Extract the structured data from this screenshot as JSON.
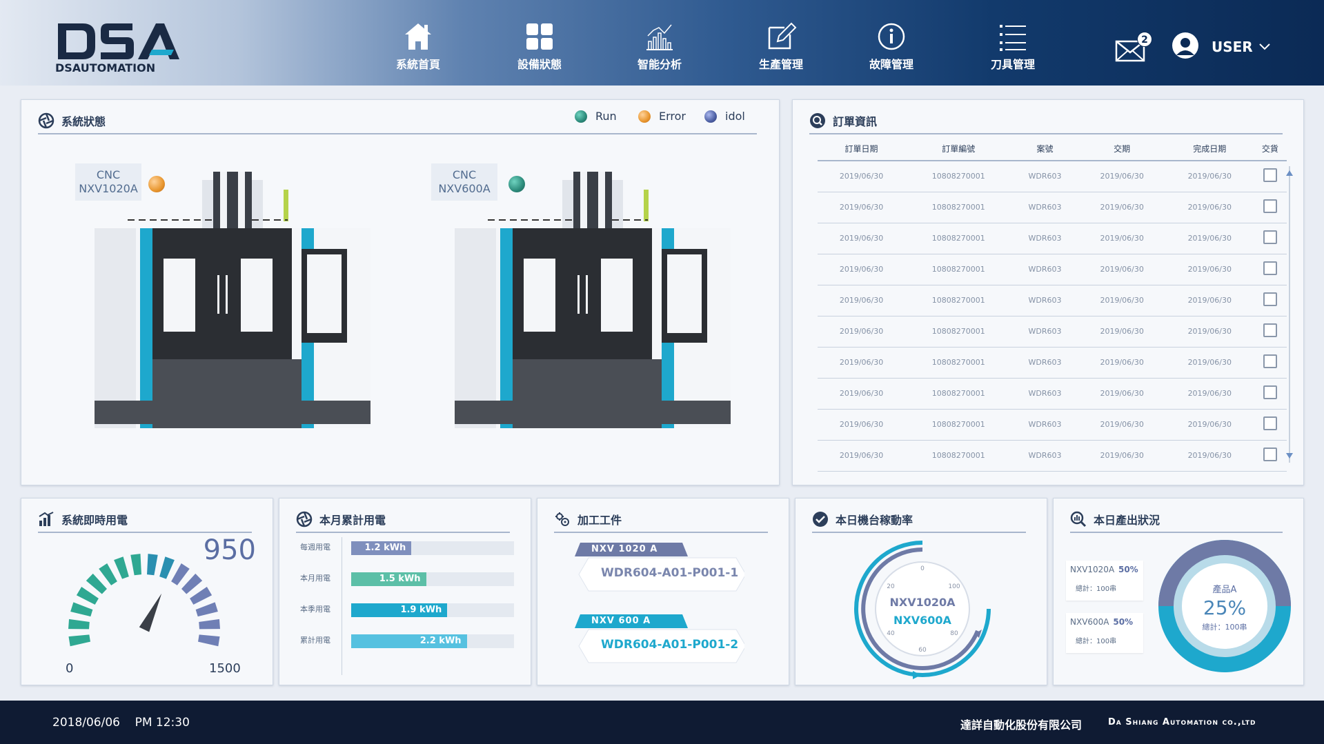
{
  "header": {
    "logo_text": "DSA",
    "logo_subtext": "DSAUTOMATION",
    "nav": [
      {
        "label": "系統首頁",
        "icon": "home-icon"
      },
      {
        "label": "設備狀態",
        "icon": "grid-icon"
      },
      {
        "label": "智能分析",
        "icon": "chart-icon"
      },
      {
        "label": "生產管理",
        "icon": "edit-icon"
      },
      {
        "label": "故障管理",
        "icon": "info-icon"
      },
      {
        "label": "刀具管理",
        "icon": "list-icon"
      }
    ],
    "mail_badge": "2",
    "user": "USER"
  },
  "status": {
    "title": "系統狀態",
    "legend": [
      {
        "label": "Run",
        "color": "#2b8a7a"
      },
      {
        "label": "Error",
        "color": "#e8962e"
      },
      {
        "label": "idol",
        "color": "#4c5fa3"
      }
    ],
    "machines": [
      {
        "line1": "CNC",
        "line2": "NXV1020A",
        "status_color": "#e8962e"
      },
      {
        "line1": "CNC",
        "line2": "NXV600A",
        "status_color": "#2b8a7a"
      }
    ]
  },
  "orders": {
    "title": "訂單資訊",
    "columns": [
      "訂單日期",
      "訂單編號",
      "案號",
      "交期",
      "完成日期",
      "交貨"
    ],
    "rows": [
      [
        "2019/06/30",
        "10808270001",
        "WDR603",
        "2019/06/30",
        "2019/06/30"
      ],
      [
        "2019/06/30",
        "10808270001",
        "WDR603",
        "2019/06/30",
        "2019/06/30"
      ],
      [
        "2019/06/30",
        "10808270001",
        "WDR603",
        "2019/06/30",
        "2019/06/30"
      ],
      [
        "2019/06/30",
        "10808270001",
        "WDR603",
        "2019/06/30",
        "2019/06/30"
      ],
      [
        "2019/06/30",
        "10808270001",
        "WDR603",
        "2019/06/30",
        "2019/06/30"
      ],
      [
        "2019/06/30",
        "10808270001",
        "WDR603",
        "2019/06/30",
        "2019/06/30"
      ],
      [
        "2019/06/30",
        "10808270001",
        "WDR603",
        "2019/06/30",
        "2019/06/30"
      ],
      [
        "2019/06/30",
        "10808270001",
        "WDR603",
        "2019/06/30",
        "2019/06/30"
      ],
      [
        "2019/06/30",
        "10808270001",
        "WDR603",
        "2019/06/30",
        "2019/06/30"
      ],
      [
        "2019/06/30",
        "10808270001",
        "WDR603",
        "2019/06/30",
        "2019/06/30"
      ]
    ]
  },
  "power": {
    "title": "系統即時用電",
    "value": "950",
    "min": "0",
    "max": "1500",
    "fraction": 0.63
  },
  "monthly": {
    "title": "本月累計用電",
    "bars": [
      {
        "label": "每週用電",
        "value": "1.2 kWh",
        "fraction": 0.37,
        "color": "#7f8fbd"
      },
      {
        "label": "本月用電",
        "value": "1.5 kWh",
        "fraction": 0.46,
        "color": "#5cbfa7"
      },
      {
        "label": "本季用電",
        "value": "1.9 kWh",
        "fraction": 0.59,
        "color": "#1ea8cd"
      },
      {
        "label": "累計用電",
        "value": "2.2 kWh",
        "fraction": 0.71,
        "color": "#56c1e0"
      }
    ]
  },
  "work": {
    "title": "加工工件",
    "items": [
      {
        "machine": "NXV 1020 A",
        "part": "WDR604-A01-P001-1",
        "tab_color": "#6e7aa6",
        "text_color": "#7a86ad"
      },
      {
        "machine": "NXV 600 A",
        "part": "WDR604-A01-P001-2",
        "tab_color": "#1ea8cd",
        "text_color": "#1ea8cd"
      }
    ]
  },
  "utilization": {
    "title": "本日機台稼動率",
    "ticks": [
      "0",
      "20",
      "100",
      "40",
      "80",
      "60"
    ],
    "machine1": "NXV1020A",
    "machine2": "NXV600A"
  },
  "output": {
    "title": "本日產出狀況",
    "items": [
      {
        "name": "NXV1020A",
        "pct": "50%",
        "total": "總計：100串"
      },
      {
        "name": "NXV600A",
        "pct": "50%",
        "total": "總計：100串"
      }
    ],
    "center_label": "產品A",
    "center_pct": "25%",
    "center_total": "總計：100串",
    "fraction": 0.5
  },
  "footer": {
    "datetime": "2018/06/06    PM 12:30",
    "company": "達詳自動化股份有限公司",
    "company_en": "Da Shiang Automation co.,ltd"
  }
}
